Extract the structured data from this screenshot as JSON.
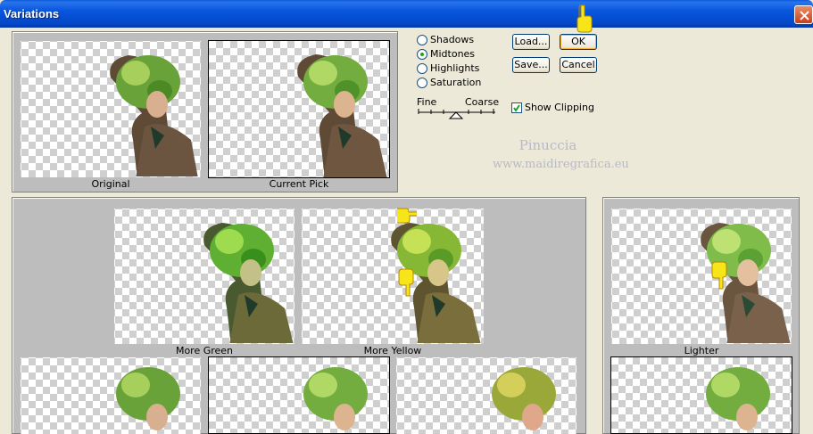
{
  "window": {
    "title": "Variations"
  },
  "preview": {
    "original_label": "Original",
    "current_label": "Current Pick"
  },
  "range": {
    "options": [
      {
        "label": "Shadows",
        "selected": false
      },
      {
        "label": "Midtones",
        "selected": true
      },
      {
        "label": "Highlights",
        "selected": false
      },
      {
        "label": "Saturation",
        "selected": false
      }
    ]
  },
  "slider": {
    "fine_label": "Fine",
    "coarse_label": "Coarse"
  },
  "buttons": {
    "load": "Load...",
    "ok": "OK",
    "save": "Save...",
    "cancel": "Cancel"
  },
  "show_clipping": {
    "label": "Show Clipping",
    "checked": true
  },
  "watermark": {
    "line1": "Pinuccia",
    "line2": "www.maidiregrafica.eu"
  },
  "variations": {
    "more_green": "More Green",
    "more_yellow": "More Yellow",
    "lighter": "Lighter"
  },
  "colors": {
    "titlebar": "#0855dd",
    "panel": "#bdbdbd",
    "window_bg": "#ece9d8",
    "accent_yellow": "#f7e51a"
  }
}
